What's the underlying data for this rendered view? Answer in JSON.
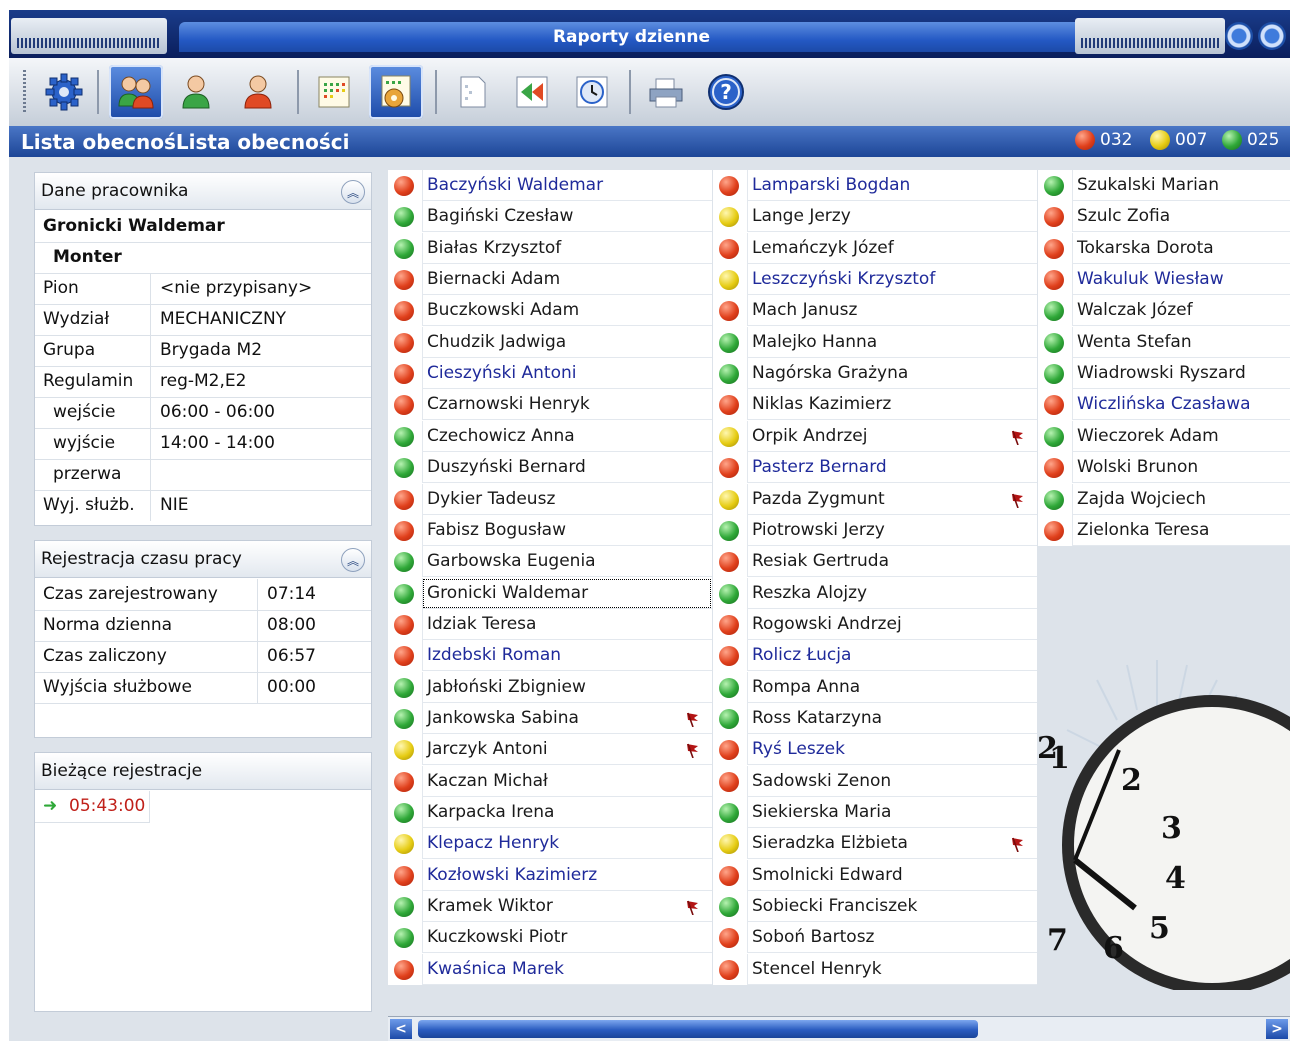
{
  "window": {
    "title": "Raporty dzienne"
  },
  "toolbar": {
    "buttons": [
      {
        "icon": "gear-icon"
      },
      {
        "icon": "users-icon",
        "active": true
      },
      {
        "icon": "user-green-icon"
      },
      {
        "icon": "user-red-icon"
      },
      {
        "icon": "calendar-grid-icon"
      },
      {
        "icon": "calendar-gear-icon",
        "active": true
      },
      {
        "icon": "document-icon"
      },
      {
        "icon": "rewind-icon"
      },
      {
        "icon": "clock-icon"
      },
      {
        "icon": "printer-icon"
      },
      {
        "icon": "help-icon"
      }
    ]
  },
  "list_header": {
    "title": "Lista obecnośLista obecności",
    "counts": {
      "red": "032",
      "yellow": "007",
      "green": "025"
    }
  },
  "employee_panel": {
    "title": "Dane pracownika",
    "name": "Gronicki Waldemar",
    "position": "Monter",
    "fields": [
      {
        "label": "Pion",
        "value": "<nie przypisany>"
      },
      {
        "label": "Wydział",
        "value": "MECHANICZNY"
      },
      {
        "label": "Grupa",
        "value": "Brygada M2"
      },
      {
        "label": "Regulamin",
        "value": "reg-M2,E2"
      },
      {
        "label": "wejście",
        "value": "06:00 - 06:00"
      },
      {
        "label": "wyjście",
        "value": "14:00 - 14:00"
      },
      {
        "label": "przerwa",
        "value": ""
      },
      {
        "label": "Wyj. służb.",
        "value": "NIE"
      }
    ]
  },
  "time_panel": {
    "title": "Rejestracja czasu pracy",
    "rows": [
      {
        "label": "Czas zarejestrowany",
        "value": "07:14"
      },
      {
        "label": "Norma dzienna",
        "value": "08:00"
      },
      {
        "label": "Czas zaliczony",
        "value": "06:57"
      },
      {
        "label": "Wyjścia służbowe",
        "value": "00:00"
      }
    ]
  },
  "current_panel": {
    "title": "Bieżące rejestracje",
    "entries": [
      {
        "time": "05:43:00"
      }
    ]
  },
  "colors": {
    "red": "#e0401c",
    "yellow": "#e6cc14",
    "green": "#2fa838",
    "name_blue": "#1f2a9a",
    "title_blue": "#2459c4"
  },
  "employees": [
    [
      {
        "name": "Baczyński Waldemar",
        "status": "red",
        "blue": true
      },
      {
        "name": "Bagiński Czesław",
        "status": "green"
      },
      {
        "name": "Białas Krzysztof",
        "status": "green"
      },
      {
        "name": "Biernacki Adam",
        "status": "red"
      },
      {
        "name": "Buczkowski Adam",
        "status": "red"
      },
      {
        "name": "Chudzik Jadwiga",
        "status": "red"
      },
      {
        "name": "Cieszyński Antoni",
        "status": "red",
        "blue": true
      },
      {
        "name": "Czarnowski Henryk",
        "status": "red"
      },
      {
        "name": "Czechowicz Anna",
        "status": "green"
      },
      {
        "name": "Duszyński Bernard",
        "status": "green"
      },
      {
        "name": "Dykier Tadeusz",
        "status": "red"
      },
      {
        "name": "Fabisz Bogusław",
        "status": "red"
      },
      {
        "name": "Garbowska Eugenia",
        "status": "green"
      },
      {
        "name": "Gronicki Waldemar",
        "status": "green",
        "selected": true
      },
      {
        "name": "Idziak Teresa",
        "status": "red"
      },
      {
        "name": "Izdebski Roman",
        "status": "red",
        "blue": true
      },
      {
        "name": "Jabłoński Zbigniew",
        "status": "green"
      },
      {
        "name": "Jankowska Sabina",
        "status": "green",
        "flag": true
      },
      {
        "name": "Jarczyk Antoni",
        "status": "yellow",
        "flag": true
      },
      {
        "name": "Kaczan Michał",
        "status": "red"
      },
      {
        "name": "Karpacka Irena",
        "status": "green"
      },
      {
        "name": "Klepacz Henryk",
        "status": "yellow",
        "blue": true
      },
      {
        "name": "Kozłowski Kazimierz",
        "status": "red",
        "blue": true
      },
      {
        "name": "Kramek Wiktor",
        "status": "green",
        "flag": true
      },
      {
        "name": "Kuczkowski Piotr",
        "status": "green"
      },
      {
        "name": "Kwaśnica Marek",
        "status": "red",
        "blue": true
      }
    ],
    [
      {
        "name": "Lamparski Bogdan",
        "status": "red",
        "blue": true
      },
      {
        "name": "Lange Jerzy",
        "status": "yellow"
      },
      {
        "name": "Lemańczyk Józef",
        "status": "red"
      },
      {
        "name": "Leszczyński Krzysztof",
        "status": "yellow",
        "blue": true
      },
      {
        "name": "Mach Janusz",
        "status": "red"
      },
      {
        "name": "Malejko Hanna",
        "status": "green"
      },
      {
        "name": "Nagórska Grażyna",
        "status": "green"
      },
      {
        "name": "Niklas Kazimierz",
        "status": "red"
      },
      {
        "name": "Orpik Andrzej",
        "status": "yellow",
        "flag": true
      },
      {
        "name": "Pasterz Bernard",
        "status": "red",
        "blue": true
      },
      {
        "name": "Pazda Zygmunt",
        "status": "yellow",
        "flag": true
      },
      {
        "name": "Piotrowski Jerzy",
        "status": "green"
      },
      {
        "name": "Resiak Gertruda",
        "status": "red"
      },
      {
        "name": "Reszka Alojzy",
        "status": "green"
      },
      {
        "name": "Rogowski Andrzej",
        "status": "red"
      },
      {
        "name": "Rolicz Łucja",
        "status": "red",
        "blue": true
      },
      {
        "name": "Rompa Anna",
        "status": "green"
      },
      {
        "name": "Ross Katarzyna",
        "status": "green"
      },
      {
        "name": "Ryś Leszek",
        "status": "red",
        "blue": true
      },
      {
        "name": "Sadowski Zenon",
        "status": "red"
      },
      {
        "name": "Siekierska Maria",
        "status": "green"
      },
      {
        "name": "Sieradzka Elżbieta",
        "status": "yellow",
        "flag": true
      },
      {
        "name": "Smolnicki Edward",
        "status": "red"
      },
      {
        "name": "Sobiecki Franciszek",
        "status": "green"
      },
      {
        "name": "Soboń Bartosz",
        "status": "red"
      },
      {
        "name": "Stencel Henryk",
        "status": "red"
      }
    ],
    [
      {
        "name": "Szukalski Marian",
        "status": "green"
      },
      {
        "name": "Szulc Zofia",
        "status": "red"
      },
      {
        "name": "Tokarska Dorota",
        "status": "red"
      },
      {
        "name": "Wakuluk Wiesław",
        "status": "red",
        "blue": true
      },
      {
        "name": "Walczak Józef",
        "status": "green"
      },
      {
        "name": "Wenta Stefan",
        "status": "green"
      },
      {
        "name": "Wiadrowski Ryszard",
        "status": "green"
      },
      {
        "name": "Wiczlińska Czasława",
        "status": "red",
        "blue": true
      },
      {
        "name": "Wieczorek Adam",
        "status": "green"
      },
      {
        "name": "Wolski Brunon",
        "status": "red"
      },
      {
        "name": "Zajda Wojciech",
        "status": "green"
      },
      {
        "name": "Zielonka Teresa",
        "status": "red"
      }
    ]
  ],
  "clock_numerals": [
    "1",
    "2",
    "2",
    "3",
    "4",
    "5",
    "6",
    "7"
  ]
}
